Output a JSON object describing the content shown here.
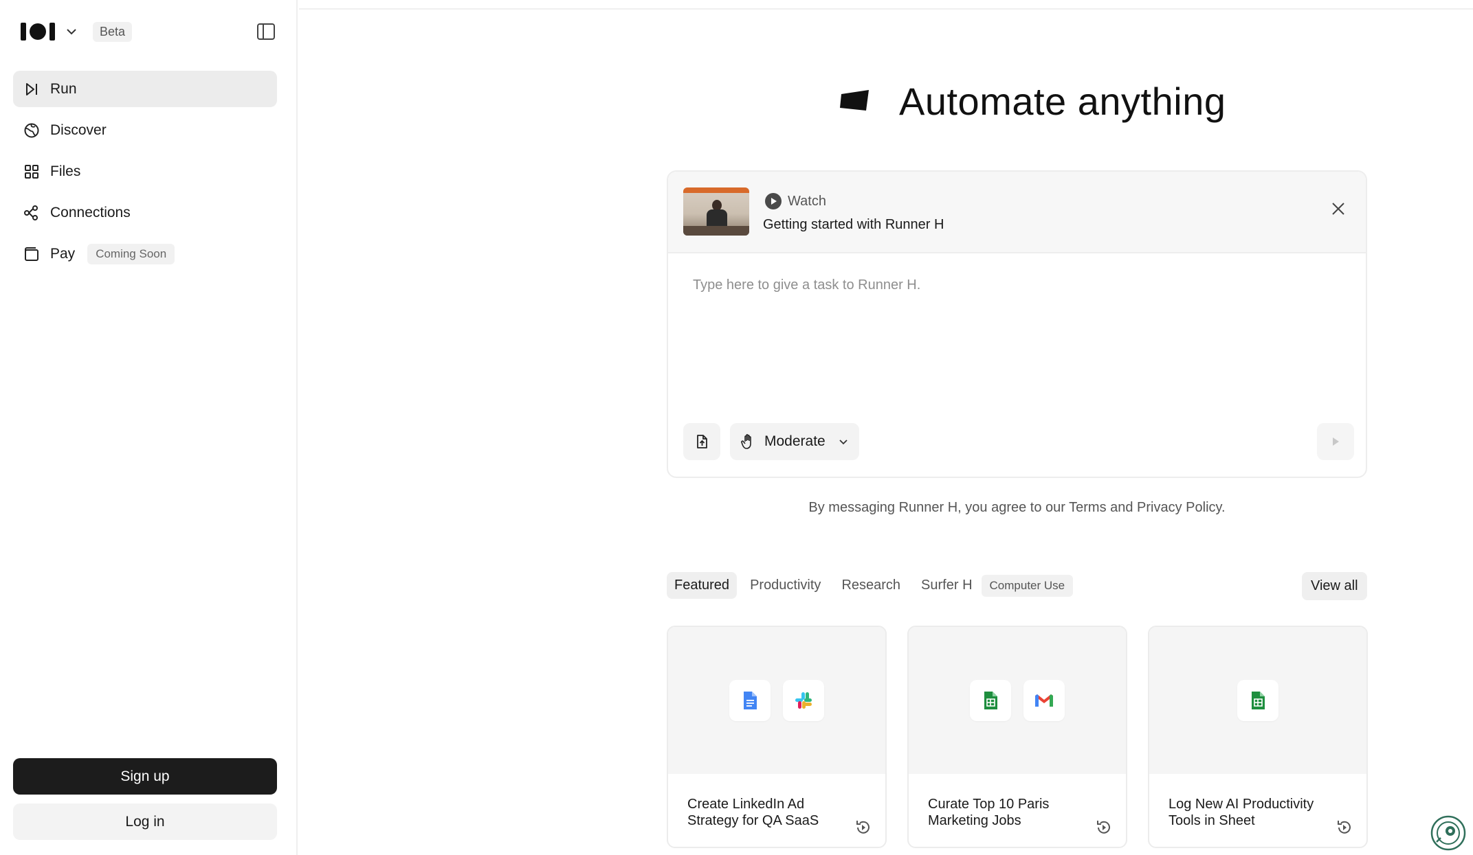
{
  "app": {
    "beta_label": "Beta"
  },
  "sidebar": {
    "items": [
      {
        "label": "Run",
        "icon": "run-icon"
      },
      {
        "label": "Discover",
        "icon": "globe-icon"
      },
      {
        "label": "Files",
        "icon": "grid-icon"
      },
      {
        "label": "Connections",
        "icon": "connections-icon"
      },
      {
        "label": "Pay",
        "icon": "wallet-icon",
        "badge": "Coming Soon"
      }
    ],
    "signup_label": "Sign up",
    "login_label": "Log in"
  },
  "hero": {
    "title": "Automate anything"
  },
  "composer": {
    "watch_label": "Watch",
    "watch_title": "Getting started with Runner H",
    "placeholder": "Type here to give a task to Runner H.",
    "mode_label": "Moderate"
  },
  "agreement": "By messaging Runner H, you agree to our Terms and Privacy Policy.",
  "tabs": {
    "items": [
      "Featured",
      "Productivity",
      "Research",
      "Surfer H"
    ],
    "badge": "Computer Use",
    "view_all": "View all"
  },
  "cards": [
    {
      "title": "Create LinkedIn Ad Strategy for QA SaaS",
      "apps": [
        "google-docs-icon",
        "slack-icon"
      ]
    },
    {
      "title": "Curate Top 10 Paris Marketing Jobs",
      "apps": [
        "google-sheets-icon",
        "gmail-icon"
      ]
    },
    {
      "title": "Log New AI Productivity Tools in Sheet",
      "apps": [
        "google-sheets-icon"
      ]
    }
  ],
  "colors": {
    "sheets_green": "#1e8e3e",
    "docs_blue": "#4285f4",
    "signup_bg": "#1c1c1c"
  }
}
